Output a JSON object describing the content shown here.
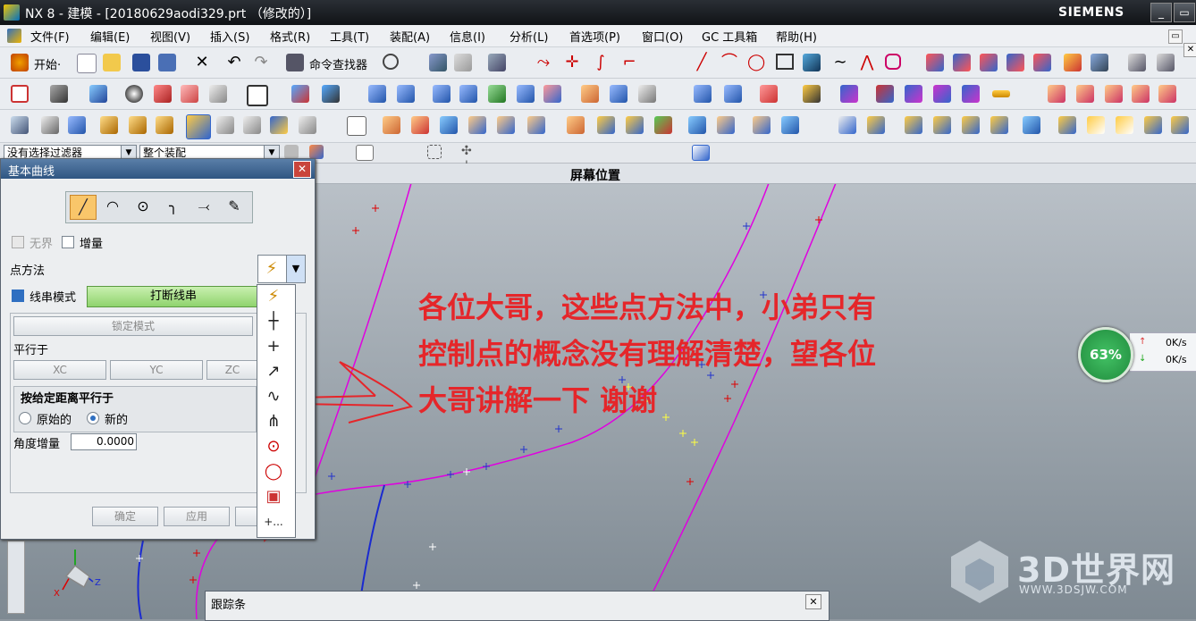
{
  "window": {
    "title": "NX 8 - 建模 - [20180629aodi329.prt （修改的）]",
    "brand": "SIEMENS",
    "minimize": "_",
    "restore": "▭"
  },
  "menu": [
    "文件(F)",
    "编辑(E)",
    "视图(V)",
    "插入(S)",
    "格式(R)",
    "工具(T)",
    "装配(A)",
    "信息(I)",
    "分析(L)",
    "首选项(P)",
    "窗口(O)",
    "GC 工具箱",
    "帮助(H)"
  ],
  "toolbar": {
    "start_label": "开始·",
    "command_finder": "命令查找器"
  },
  "filters": {
    "selection_filter": "没有选择过滤器",
    "assembly_scope": "整个装配"
  },
  "view": {
    "header": "屏幕位置"
  },
  "dialog": {
    "title": "基本曲线",
    "infinite": "无界",
    "incremental": "增量",
    "point_method": "点方法",
    "string_mode": "线串模式",
    "break_string": "打断线串",
    "lock_mode": "锁定模式",
    "parallel_to": "平行于",
    "xc": "XC",
    "yc": "YC",
    "zc": "ZC",
    "parallel_distance": "按给定距离平行于",
    "original": "原始的",
    "new": "新的",
    "angle_increment": "角度增量",
    "angle_value": "0.0000",
    "ok": "确定",
    "apply": "应用"
  },
  "point_menu_icons": [
    "inferred-point-icon",
    "cursor-location-icon",
    "existing-point-icon",
    "end-point-icon",
    "control-point-icon",
    "intersection-point-icon",
    "arc-center-icon",
    "quadrant-point-icon",
    "point-on-face-icon",
    "point-constructor-icon"
  ],
  "tracker": {
    "title": "跟踪条"
  },
  "net_widget": {
    "percent": "63%",
    "up": "0K/s",
    "down": "0K/s"
  },
  "annotation": {
    "line1": "各位大哥，这些点方法中，小弟只有",
    "line2": "控制点的概念没有理解清楚，望各位",
    "line3": "大哥讲解一下 谢谢"
  },
  "watermark": {
    "brand": "3D世界网",
    "url": "WWW.3DSJW.COM"
  },
  "colors": {
    "curve_magenta": "#e000e0",
    "curve_blue": "#1a2ad0",
    "annotation_red": "#e5262a"
  }
}
